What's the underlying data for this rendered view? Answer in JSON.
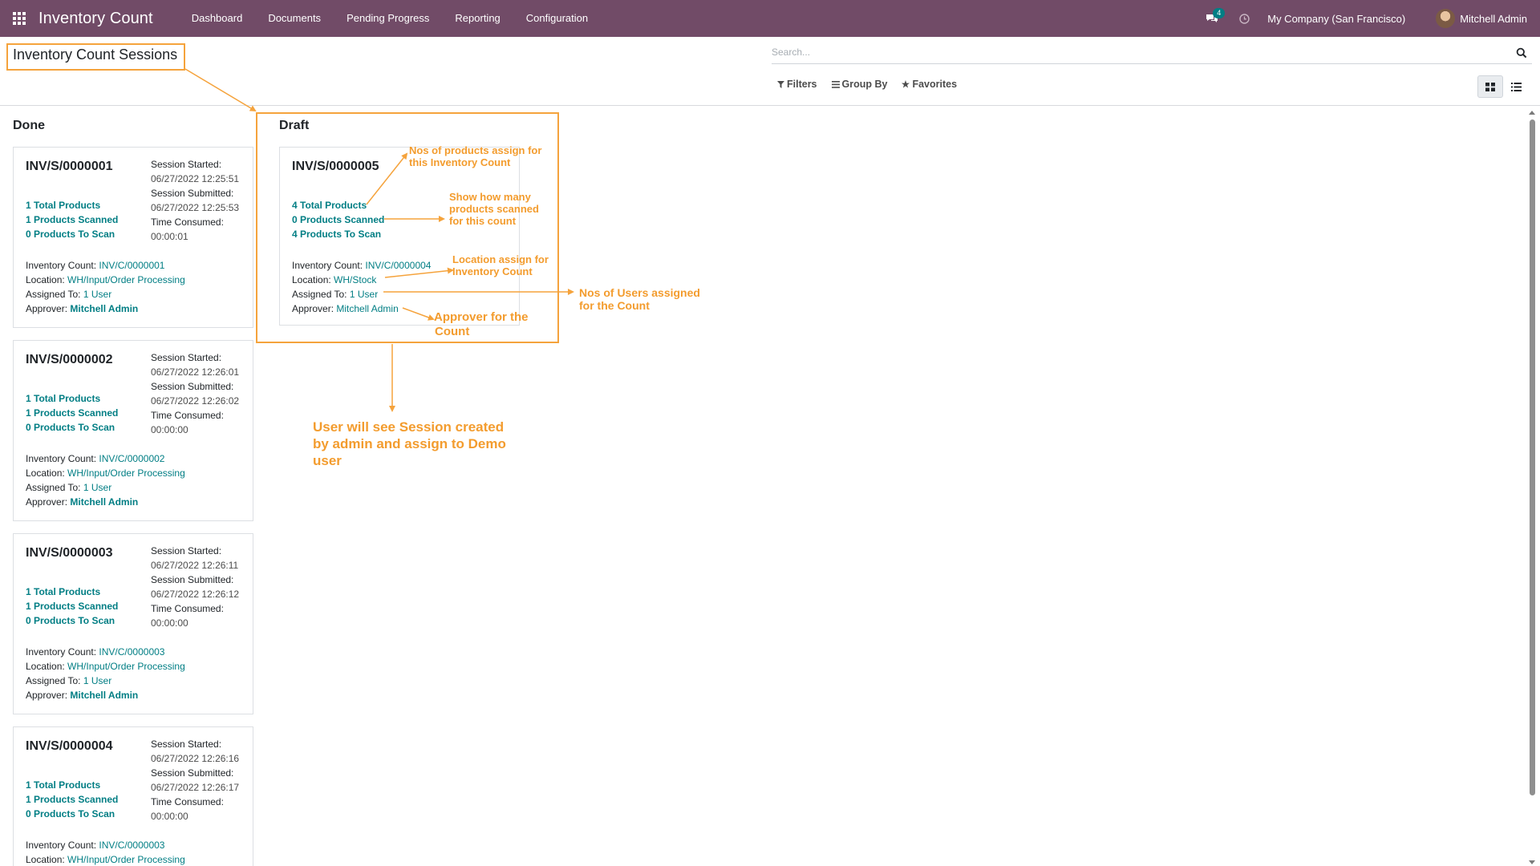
{
  "app": {
    "title": "Inventory Count",
    "menu": [
      "Dashboard",
      "Documents",
      "Pending Progress",
      "Reporting",
      "Configuration"
    ],
    "message_count": "4",
    "company": "My Company (San Francisco)",
    "user": "Mitchell Admin"
  },
  "control_panel": {
    "title": "Inventory Count Sessions",
    "search_placeholder": "Search...",
    "filters_label": "Filters",
    "group_by_label": "Group By",
    "favorites_label": "Favorites",
    "active_view": "kanban"
  },
  "columns": [
    {
      "name": "Done",
      "cards": [
        {
          "ref": "INV/S/0000001",
          "total": "1 Total Products",
          "scanned": "1 Products Scanned",
          "to_scan": "0 Products To Scan",
          "started_label": "Session Started:",
          "started": "06/27/2022 12:25:51",
          "submitted_label": "Session Submitted:",
          "submitted": "06/27/2022 12:25:53",
          "consumed_label": "Time Consumed:",
          "consumed": "00:00:01",
          "count_label": "Inventory Count:",
          "count": "INV/C/0000001",
          "location_label": "Location:",
          "location": "WH/Input/Order Processing",
          "assigned_label": "Assigned To:",
          "assigned": "1 User",
          "approver_label": "Approver:",
          "approver": "Mitchell Admin"
        },
        {
          "ref": "INV/S/0000002",
          "total": "1 Total Products",
          "scanned": "1 Products Scanned",
          "to_scan": "0 Products To Scan",
          "started_label": "Session Started:",
          "started": "06/27/2022 12:26:01",
          "submitted_label": "Session Submitted:",
          "submitted": "06/27/2022 12:26:02",
          "consumed_label": "Time Consumed:",
          "consumed": "00:00:00",
          "count_label": "Inventory Count:",
          "count": "INV/C/0000002",
          "location_label": "Location:",
          "location": "WH/Input/Order Processing",
          "assigned_label": "Assigned To:",
          "assigned": "1 User",
          "approver_label": "Approver:",
          "approver": "Mitchell Admin"
        },
        {
          "ref": "INV/S/0000003",
          "total": "1 Total Products",
          "scanned": "1 Products Scanned",
          "to_scan": "0 Products To Scan",
          "started_label": "Session Started:",
          "started": "06/27/2022 12:26:11",
          "submitted_label": "Session Submitted:",
          "submitted": "06/27/2022 12:26:12",
          "consumed_label": "Time Consumed:",
          "consumed": "00:00:00",
          "count_label": "Inventory Count:",
          "count": "INV/C/0000003",
          "location_label": "Location:",
          "location": "WH/Input/Order Processing",
          "assigned_label": "Assigned To:",
          "assigned": "1 User",
          "approver_label": "Approver:",
          "approver": "Mitchell Admin"
        },
        {
          "ref": "INV/S/0000004",
          "total": "1 Total Products",
          "scanned": "1 Products Scanned",
          "to_scan": "0 Products To Scan",
          "started_label": "Session Started:",
          "started": "06/27/2022 12:26:16",
          "submitted_label": "Session Submitted:",
          "submitted": "06/27/2022 12:26:17",
          "consumed_label": "Time Consumed:",
          "consumed": "00:00:00",
          "count_label": "Inventory Count:",
          "count": "INV/C/0000003",
          "location_label": "Location:",
          "location": "WH/Input/Order Processing"
        }
      ]
    },
    {
      "name": "Draft",
      "cards": [
        {
          "ref": "INV/S/0000005",
          "total": "4 Total Products",
          "scanned": "0 Products Scanned",
          "to_scan": "4 Products To Scan",
          "count_label": "Inventory Count:",
          "count": "INV/C/0000004",
          "location_label": "Location:",
          "location": "WH/Stock",
          "assigned_label": "Assigned To:",
          "assigned": "1 User",
          "approver_label": "Approver:",
          "approver": "Mitchell Admin"
        }
      ]
    }
  ],
  "annotations": {
    "products_line1": "Nos of products assign for",
    "products_line2": "this Inventory Count",
    "scanned_line1": "Show how many",
    "scanned_line2": "products scanned",
    "scanned_line3": "for this count",
    "location_line1": "Location assign for",
    "location_line2": "Inventory Count",
    "users_line1": "Nos of Users assigned",
    "users_line2": "for the Count",
    "approver_line1": "Approver for the",
    "approver_line2": "Count",
    "session_line1": "User will see Session created",
    "session_line2": "by admin and assign to Demo",
    "session_line3": "user"
  },
  "colors": {
    "navbar": "#714b67",
    "link_teal": "#017e84",
    "annotation_orange": "#f5a33c"
  }
}
